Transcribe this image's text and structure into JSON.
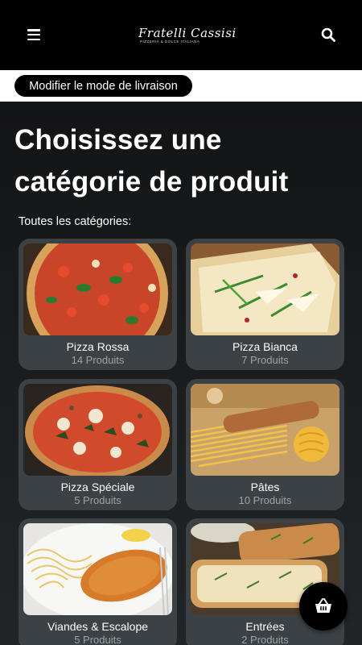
{
  "header": {
    "menu_icon": "hamburger-menu-icon",
    "logo_text": "Fratelli Cassisi",
    "logo_subtitle": "PIZZERIA & DOLCE ITALIANA",
    "search_icon": "search-icon"
  },
  "delivery": {
    "button_label": "Modifier le mode de livraison"
  },
  "main": {
    "title": "Choisissez une catégorie de produit",
    "section_label": "Toutes les catégories:"
  },
  "categories": [
    {
      "name": "Pizza Rossa",
      "count": "14 Produits"
    },
    {
      "name": "Pizza Bianca",
      "count": "7 Produits"
    },
    {
      "name": "Pizza Spéciale",
      "count": "5 Produits"
    },
    {
      "name": "Pâtes",
      "count": "10 Produits"
    },
    {
      "name": "Viandes & Escalope",
      "count": "5 Produits"
    },
    {
      "name": "Entrées",
      "count": "2 Produits"
    }
  ],
  "cart": {
    "icon": "shopping-basket-icon"
  },
  "colors": {
    "topbar": "#000000",
    "background": "#161819",
    "card": "#3b4145",
    "muted_text": "#9ea3a6"
  }
}
